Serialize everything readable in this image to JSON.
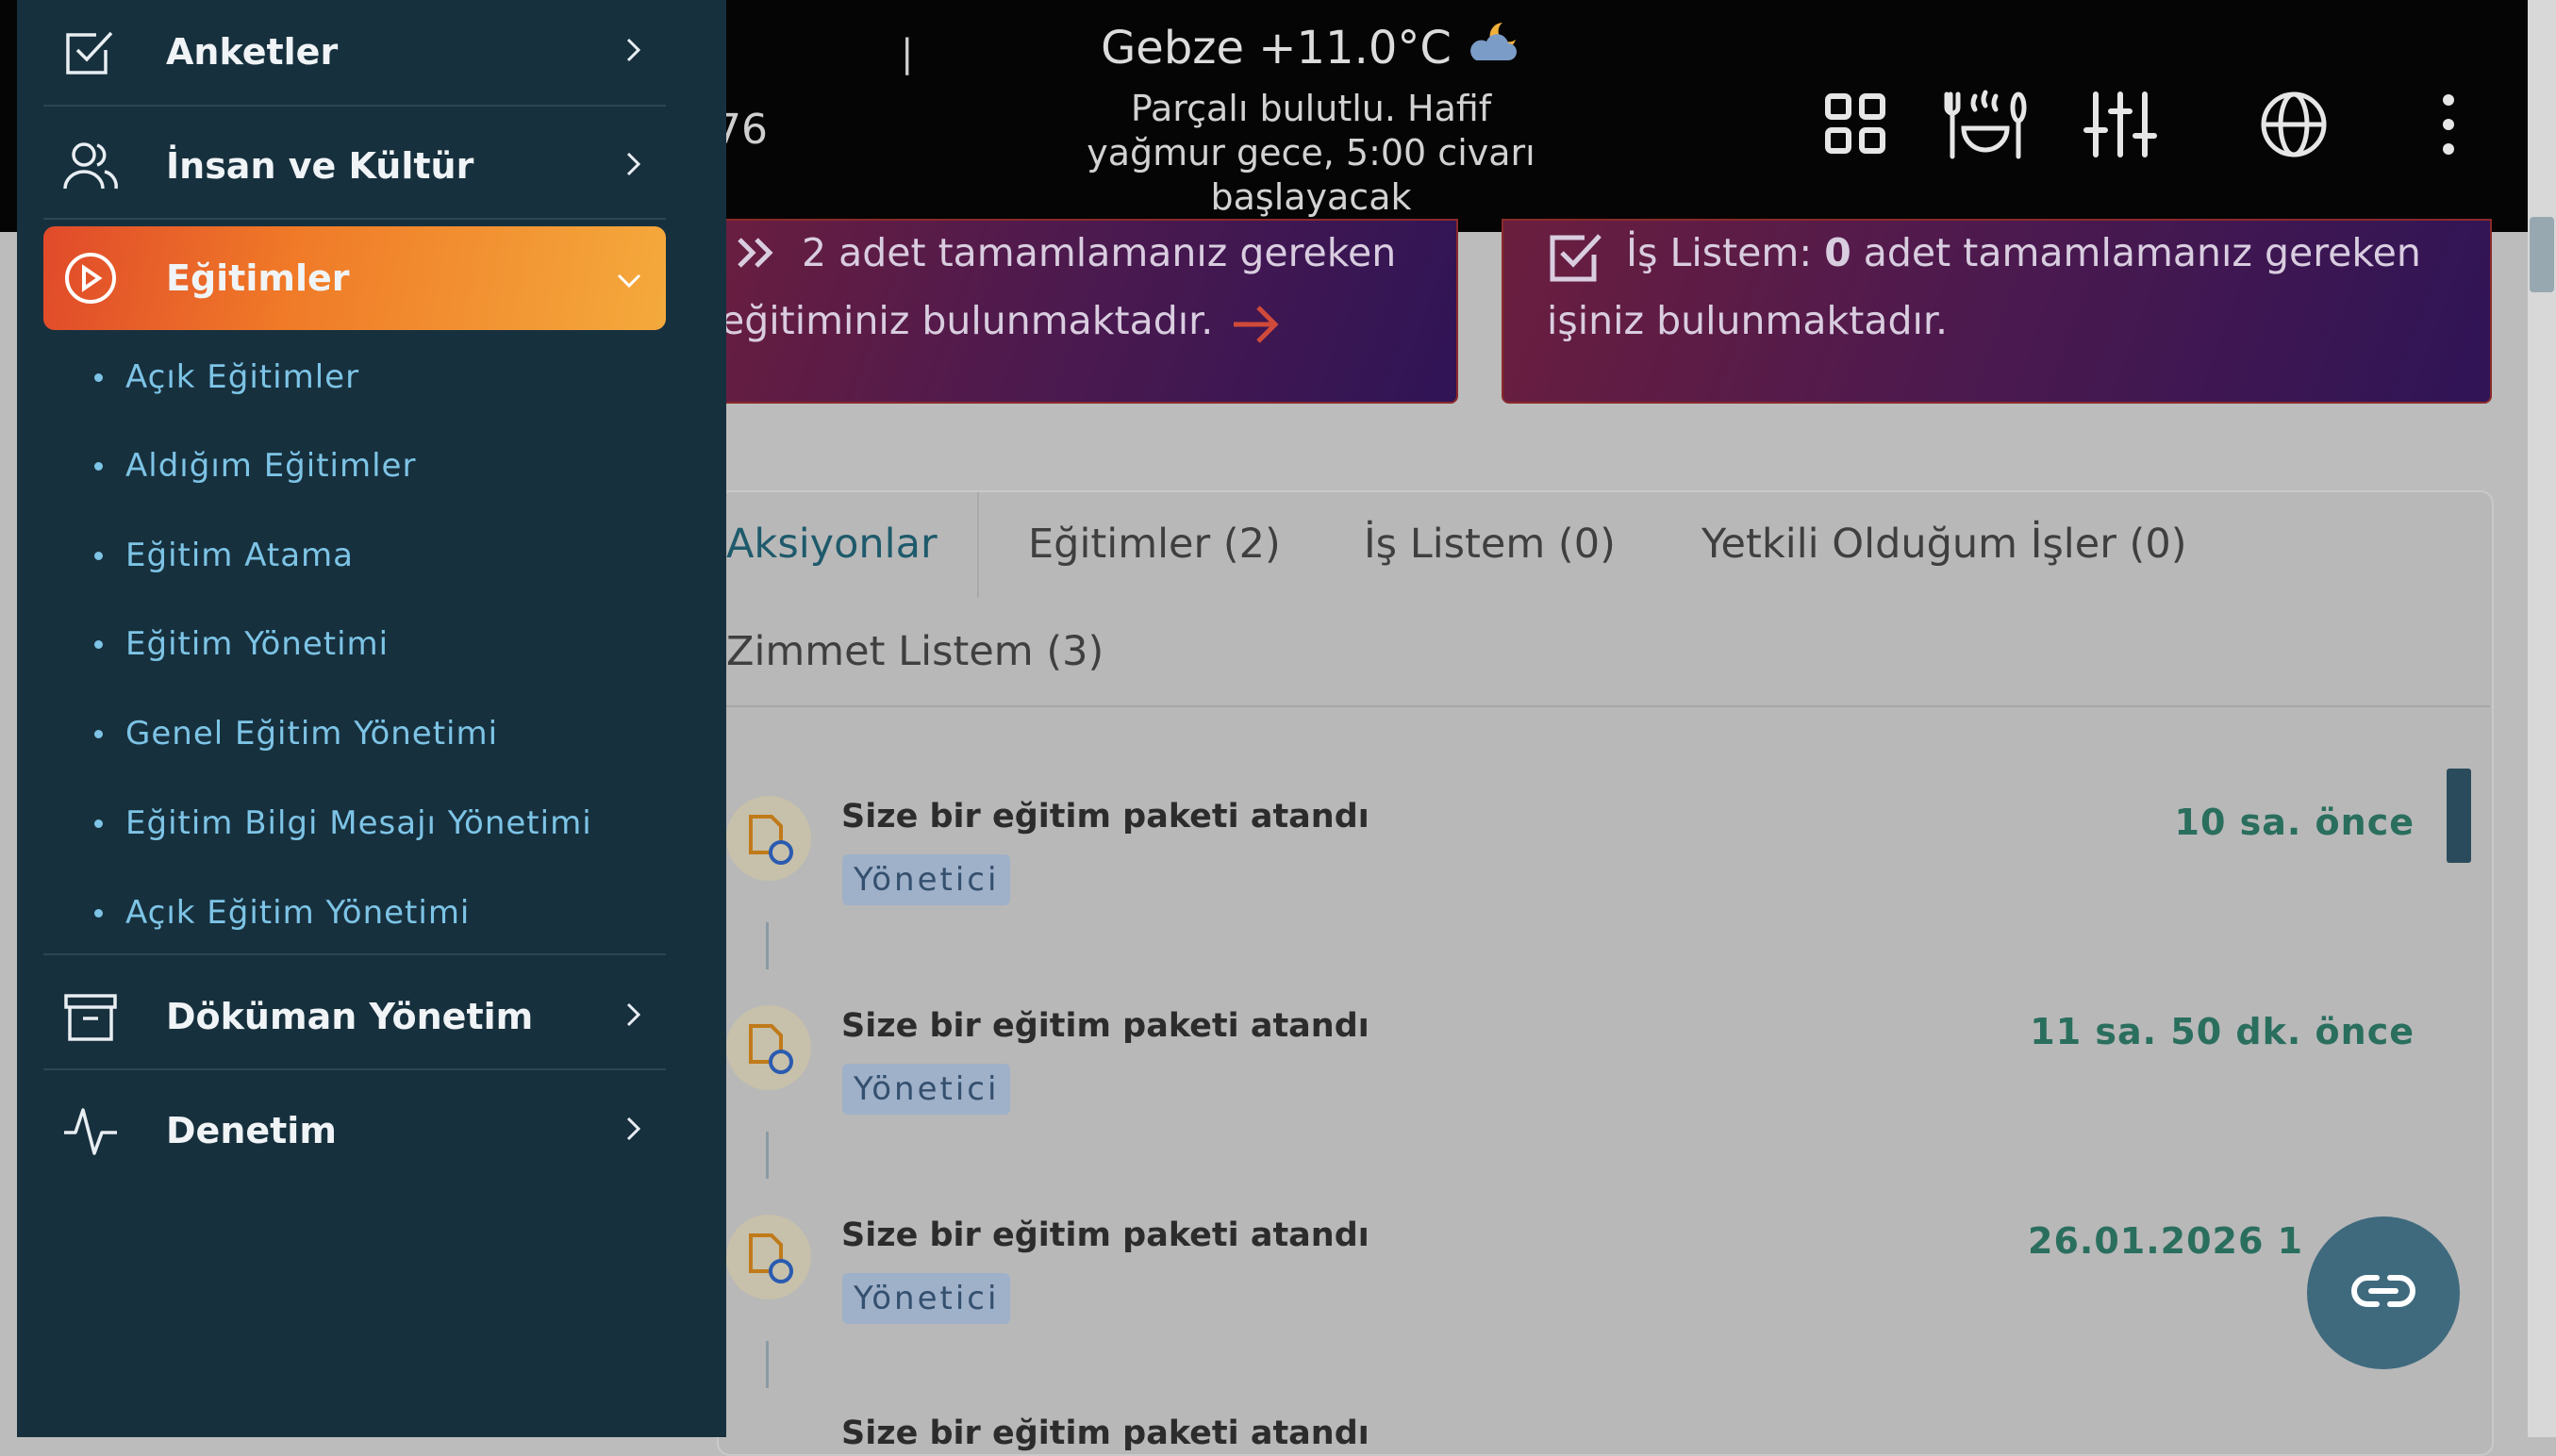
{
  "header": {
    "weather_title": "Gebze +11.0°C",
    "weather_icon": "cloud-moon-icon",
    "weather_desc": "Parçalı bulutlu. Hafif yağmur gece, 5:00 civarı başlayacak",
    "partial_left_top": ":",
    "partial_left_bottom": "76",
    "partial_pipe": "|"
  },
  "banners": {
    "trainings_text_1": "2 adet tamamlamanız gereken",
    "trainings_text_2": "eğitiminiz bulunmaktadır.",
    "tasks_prefix": "İş Listem:",
    "tasks_count": "0",
    "tasks_text_1": "adet tamamlamanız gereken",
    "tasks_text_2": "işiniz bulunmaktadır."
  },
  "tabs": [
    {
      "label": "Aksiyonlar"
    },
    {
      "label": "Eğitimler (2)"
    },
    {
      "label": "İş Listem (0)"
    },
    {
      "label": "Yetkili Olduğum İşler (0)"
    },
    {
      "label": "Zimmet Listem (3)"
    }
  ],
  "feed": [
    {
      "title": "Size bir eğitim paketi atandı",
      "badge": "Yönetici",
      "time": "10 sa. önce"
    },
    {
      "title": "Size bir eğitim paketi atandı",
      "badge": "Yönetici",
      "time": "11 sa. 50 dk. önce"
    },
    {
      "title": "Size bir eğitim paketi atandı",
      "badge": "Yönetici",
      "time": "26.01.2026 1"
    },
    {
      "title": "Size bir eğitim paketi atandı"
    }
  ],
  "sidebar": {
    "items": [
      {
        "label": "Anketler",
        "icon": "checkbox-icon"
      },
      {
        "label": "İnsan ve Kültür",
        "icon": "users-icon"
      },
      {
        "label": "Eğitimler",
        "icon": "play-circle-icon"
      },
      {
        "label": "Döküman Yönetim",
        "icon": "archive-icon"
      },
      {
        "label": "Denetim",
        "icon": "activity-icon"
      }
    ],
    "subitems": [
      "Açık Eğitimler",
      "Aldığım Eğitimler",
      "Eğitim Atama",
      "Eğitim Yönetimi",
      "Genel Eğitim Yönetimi",
      "Eğitim Bilgi Mesajı Yönetimi",
      "Açık Eğitim Yönetimi"
    ]
  },
  "colors": {
    "sidebar_bg": "#17303e",
    "active_gradient_start": "#e04a2a",
    "active_gradient_end": "#f4aa3c",
    "subitem_text": "#7dc4e6",
    "fab_bg": "#3f6a7e",
    "time_text": "#2a6e5e"
  }
}
